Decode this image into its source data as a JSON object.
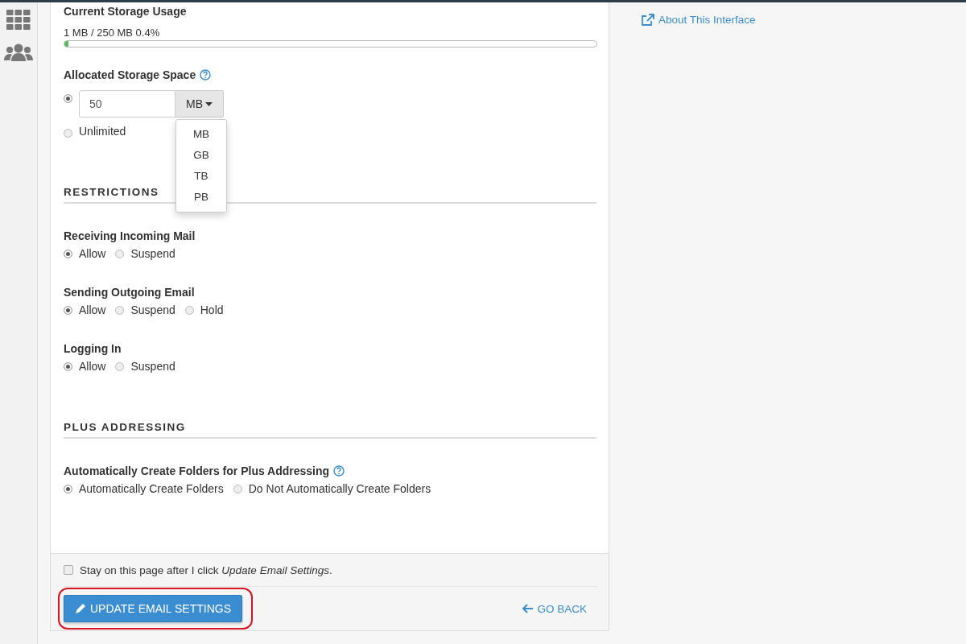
{
  "sidebar": {
    "items": [
      {
        "kind": "grid",
        "selected": false
      },
      {
        "kind": "users",
        "selected": false
      }
    ]
  },
  "storage": {
    "usage_label": "Current Storage Usage",
    "usage_text": "1 MB / 250 MB 0.4%",
    "level": 0.004,
    "allocated_label": "Allocated Storage Space",
    "quota_value": "50",
    "unit": "MB",
    "options": [
      {
        "kind": "quota",
        "selected": true
      },
      {
        "kind": "unlimited",
        "label": "Unlimited",
        "selected": false
      }
    ],
    "unit_menu": {
      "expanded": true,
      "items": [
        "MB",
        "GB",
        "TB",
        "PB"
      ]
    }
  },
  "sections": [
    {
      "heading": "RESTRICTIONS",
      "groups": [
        {
          "label": "Receiving Incoming Mail",
          "help": false,
          "choices": [
            {
              "label": "Allow",
              "selected": true
            },
            {
              "label": "Suspend",
              "selected": false
            }
          ]
        },
        {
          "label": "Sending Outgoing Email",
          "help": false,
          "choices": [
            {
              "label": "Allow",
              "selected": true
            },
            {
              "label": "Suspend",
              "selected": false
            },
            {
              "label": "Hold",
              "selected": false
            }
          ]
        },
        {
          "label": "Logging In",
          "help": false,
          "choices": [
            {
              "label": "Allow",
              "selected": true
            },
            {
              "label": "Suspend",
              "selected": false
            }
          ]
        }
      ]
    },
    {
      "heading": "PLUS ADDRESSING",
      "groups": [
        {
          "label": "Automatically Create Folders for Plus Addressing",
          "help": true,
          "choices": [
            {
              "label": "Automatically Create Folders",
              "selected": true
            },
            {
              "label": "Do Not Automatically Create Folders",
              "selected": false
            }
          ]
        }
      ]
    }
  ],
  "footer": {
    "stay_text": "Stay on this page after I click *Update Email Settings*.",
    "stay_checked": false,
    "update_button": "UPDATE EMAIL SETTINGS",
    "highlighted": true,
    "back_link": "GO BACK"
  },
  "about_link": "About This Interface"
}
